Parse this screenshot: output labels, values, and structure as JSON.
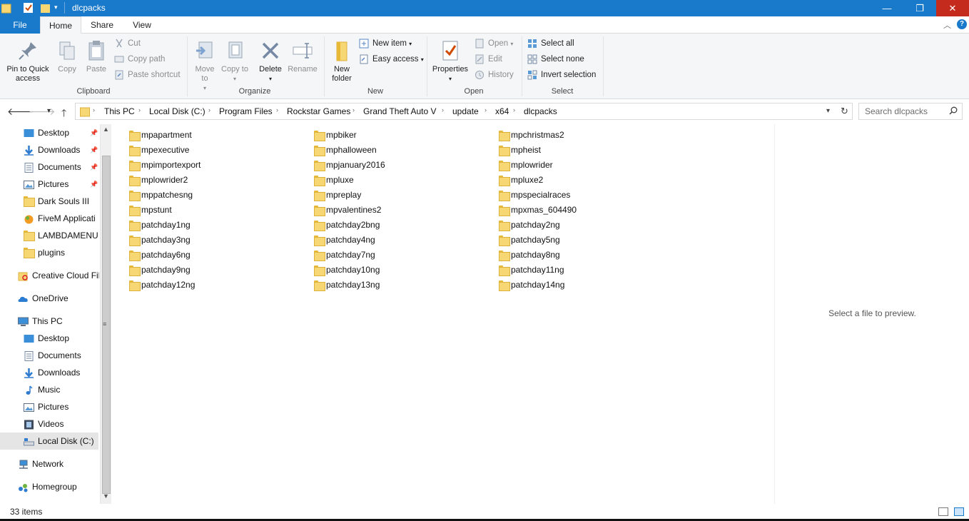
{
  "window": {
    "title": "dlcpacks",
    "minimize": "—",
    "maximize": "❐",
    "close": "✕"
  },
  "ribbon_tabs": [
    "File",
    "Home",
    "Share",
    "View"
  ],
  "ribbon": {
    "clipboard": {
      "label": "Clipboard",
      "pin": "Pin to Quick access",
      "copy": "Copy",
      "paste": "Paste",
      "cut": "Cut",
      "copy_path": "Copy path",
      "paste_shortcut": "Paste shortcut"
    },
    "organize": {
      "label": "Organize",
      "move_to": "Move to",
      "copy_to": "Copy to",
      "delete": "Delete",
      "rename": "Rename"
    },
    "new": {
      "label": "New",
      "new_folder": "New folder",
      "new_item": "New item",
      "easy_access": "Easy access"
    },
    "open": {
      "label": "Open",
      "properties": "Properties",
      "open": "Open",
      "edit": "Edit",
      "history": "History"
    },
    "select": {
      "label": "Select",
      "select_all": "Select all",
      "select_none": "Select none",
      "invert_selection": "Invert selection"
    }
  },
  "breadcrumb": [
    "This PC",
    "Local Disk (C:)",
    "Program Files",
    "Rockstar Games",
    "Grand Theft Auto V",
    "update",
    "x64",
    "dlcpacks"
  ],
  "search": {
    "placeholder": "Search dlcpacks"
  },
  "nav": {
    "quick_access": [
      {
        "label": "Desktop",
        "icon": "desktop-icon",
        "pinned": true
      },
      {
        "label": "Downloads",
        "icon": "downloads-icon",
        "pinned": true
      },
      {
        "label": "Documents",
        "icon": "documents-icon",
        "pinned": true
      },
      {
        "label": "Pictures",
        "icon": "pictures-icon",
        "pinned": true
      },
      {
        "label": "Dark Souls III",
        "icon": "folder-icon",
        "pinned": false
      },
      {
        "label": "FiveM Applicati",
        "icon": "fivem-icon",
        "pinned": false
      },
      {
        "label": "LAMBDAMENU",
        "icon": "folder-icon",
        "pinned": false
      },
      {
        "label": "plugins",
        "icon": "folder-icon",
        "pinned": false
      }
    ],
    "creative_cloud": "Creative Cloud Fil",
    "onedrive": "OneDrive",
    "this_pc": "This PC",
    "this_pc_items": [
      {
        "label": "Desktop",
        "icon": "desktop-icon"
      },
      {
        "label": "Documents",
        "icon": "documents-icon"
      },
      {
        "label": "Downloads",
        "icon": "downloads-icon"
      },
      {
        "label": "Music",
        "icon": "music-icon"
      },
      {
        "label": "Pictures",
        "icon": "pictures-icon"
      },
      {
        "label": "Videos",
        "icon": "videos-icon"
      },
      {
        "label": "Local Disk (C:)",
        "icon": "drive-icon"
      }
    ],
    "network": "Network",
    "homegroup": "Homegroup"
  },
  "files": [
    "mpapartment",
    "mpbiker",
    "mpchristmas2",
    "mpexecutive",
    "mphalloween",
    "mpheist",
    "mpimportexport",
    "mpjanuary2016",
    "mplowrider",
    "mplowrider2",
    "mpluxe",
    "mpluxe2",
    "mppatchesng",
    "mpreplay",
    "mpspecialraces",
    "mpstunt",
    "mpvalentines2",
    "mpxmas_604490",
    "patchday1ng",
    "patchday2bng",
    "patchday2ng",
    "patchday3ng",
    "patchday4ng",
    "patchday5ng",
    "patchday6ng",
    "patchday7ng",
    "patchday8ng",
    "patchday9ng",
    "patchday10ng",
    "patchday11ng",
    "patchday12ng",
    "patchday13ng",
    "patchday14ng"
  ],
  "preview": {
    "message": "Select a file to preview."
  },
  "status": {
    "item_count": "33 items"
  },
  "colors": {
    "accent": "#1979ca",
    "close_red": "#c42b1c",
    "folder": "#f7d774"
  }
}
